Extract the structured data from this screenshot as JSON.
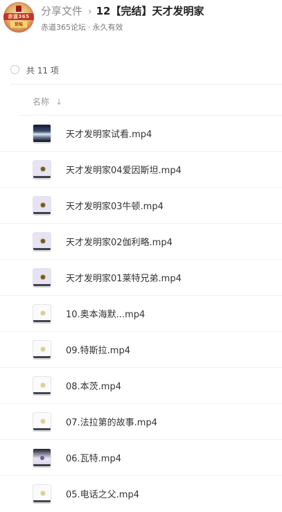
{
  "header": {
    "breadcrumb_root": "分享文件",
    "breadcrumb_sep": "›",
    "title": "12【完结】天才发明家",
    "owner": "赤道365论坛",
    "dot": "·",
    "validity": "永久有效",
    "avatar_text_1": "赤道365",
    "avatar_text_2": "论坛"
  },
  "count_label": "共 11 项",
  "column": {
    "name_label": "名称",
    "sort_glyph": "↓"
  },
  "files": [
    {
      "name": "天才发明家试看.mp4",
      "thumb": "sea"
    },
    {
      "name": "天才发明家04爱因斯坦.mp4",
      "thumb": "purple"
    },
    {
      "name": "天才发明家03牛顿.mp4",
      "thumb": "purple"
    },
    {
      "name": "天才发明家02伽利略.mp4",
      "thumb": "purple"
    },
    {
      "name": "天才发明家01莱特兄弟.mp4",
      "thumb": "purple"
    },
    {
      "name": "10.奥本海默...mp4",
      "thumb": "white"
    },
    {
      "name": "09.特斯拉.mp4",
      "thumb": "white"
    },
    {
      "name": "08.本茨.mp4",
      "thumb": "white"
    },
    {
      "name": "07.法拉第的故事.mp4",
      "thumb": "white"
    },
    {
      "name": "06.瓦特.mp4",
      "thumb": "dark"
    },
    {
      "name": "05.电话之父.mp4",
      "thumb": "white"
    }
  ]
}
